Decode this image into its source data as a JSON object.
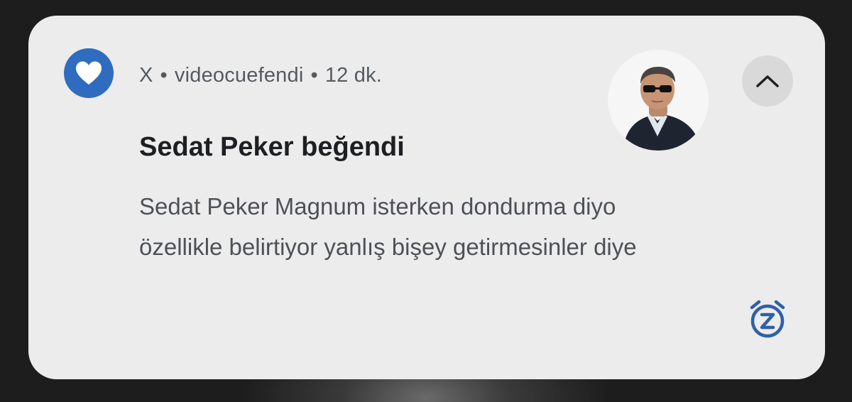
{
  "notification": {
    "app_name": "X",
    "account": "videocuefendi",
    "time": "12 dk.",
    "separator": "•",
    "title": "Sedat Peker beğendi",
    "body_lines": [
      "Sedat Peker Magnum isterken dondurma diyo",
      "özellikle belirtiyor yanlış bişey getirmesinler diye"
    ],
    "icons": {
      "app": "heart-icon",
      "expand": "chevron-up-icon",
      "snooze": "snooze-alarm-icon"
    },
    "colors": {
      "card": "#ececec",
      "app_icon_bg": "#2f6cc0",
      "snooze": "#2f5fa8"
    }
  }
}
